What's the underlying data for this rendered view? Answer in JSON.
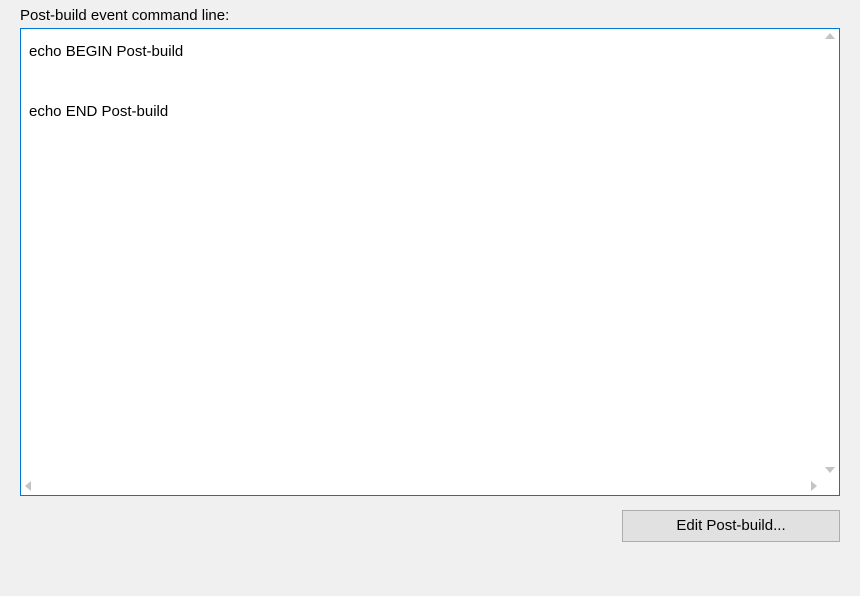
{
  "label": "Post-build event command line:",
  "textarea_value": "echo BEGIN Post-build\n\necho END Post-build",
  "edit_button_label": "Edit Post-build..."
}
